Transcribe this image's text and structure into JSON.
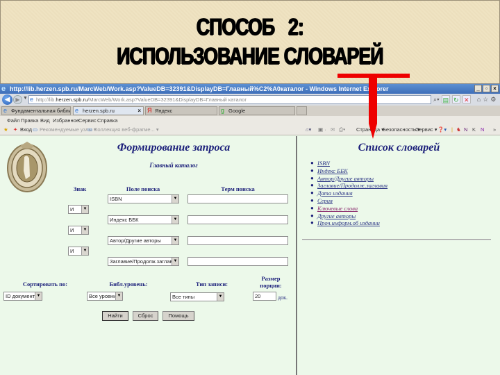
{
  "slide": {
    "title_line1": "СПОСОБ   2:",
    "title_line2": "ИСПОЛЬЗОВАНИЕ СЛОВАРЕЙ"
  },
  "browser": {
    "window_title": "http://lib.herzen.spb.ru/MarcWeb/Work.asp?ValueDB=32391&DisplayDB=Главный%C2%A0каталог - Windows Internet Explorer",
    "address_prefix": "http://lib.",
    "address_host": "herzen.spb.ru",
    "address_path": "/MarcWeb/Work.asp?ValueDB=32391&DisplayDB=Главный каталог",
    "tabs": [
      {
        "label": "Фундаментальная библиотек...",
        "icon": "ie-icon"
      },
      {
        "label": "herzen.spb.ru",
        "icon": "ie-icon",
        "active": true
      },
      {
        "label": "Яндекс",
        "icon": "yandex-icon"
      },
      {
        "label": "Google",
        "icon": "google-icon"
      }
    ],
    "menu": [
      "Файл",
      "Правка",
      "Вид",
      "Избранное",
      "Сервис",
      "Справка"
    ],
    "favorites": {
      "login": "Вход",
      "suggested_sites": "Рекомендуемые узлы ▾",
      "web_slices": "Коллекция веб-фрагме... ▾"
    },
    "command_bar": {
      "page": "Страница ▾",
      "safety": "Безопасность ▾",
      "tools": "Сервис ▾"
    }
  },
  "form": {
    "title": "Формирование запроса",
    "subtitle": "Главный каталог",
    "headers": {
      "sign": "Знак",
      "field": "Поле поиска",
      "term": "Терм поиска"
    },
    "rows": [
      {
        "field": "ISBN",
        "term": ""
      },
      {
        "operator": "И",
        "field": "Индекс ББК",
        "term": ""
      },
      {
        "operator": "И",
        "field": "Автор/Другие авторы",
        "term": ""
      },
      {
        "operator": "И",
        "field": "Заглавие/Продолж.заглавия",
        "term": ""
      }
    ],
    "options": {
      "sort_label": "Сортировать по:",
      "sort_value": "ID документа",
      "level_label": "Библ.уровень:",
      "level_value": "Все уровни",
      "type_label": "Тип записи:",
      "type_value": "Все типы",
      "size_label_1": "Размер",
      "size_label_2": "порции:",
      "size_value": "20",
      "size_unit": "док."
    },
    "buttons": {
      "find": "Найти",
      "reset": "Сброс",
      "help": "Помощь"
    }
  },
  "dictionaries": {
    "title": "Список словарей",
    "items": [
      "ISBN",
      "Индекс ББК",
      "Автор/Другие авторы",
      "Заглавие/Продолж.заглавия",
      "Дата издания",
      "Серия",
      "Ключевые слова",
      "Другие авторы",
      "Проч.информ.об издании"
    ]
  }
}
